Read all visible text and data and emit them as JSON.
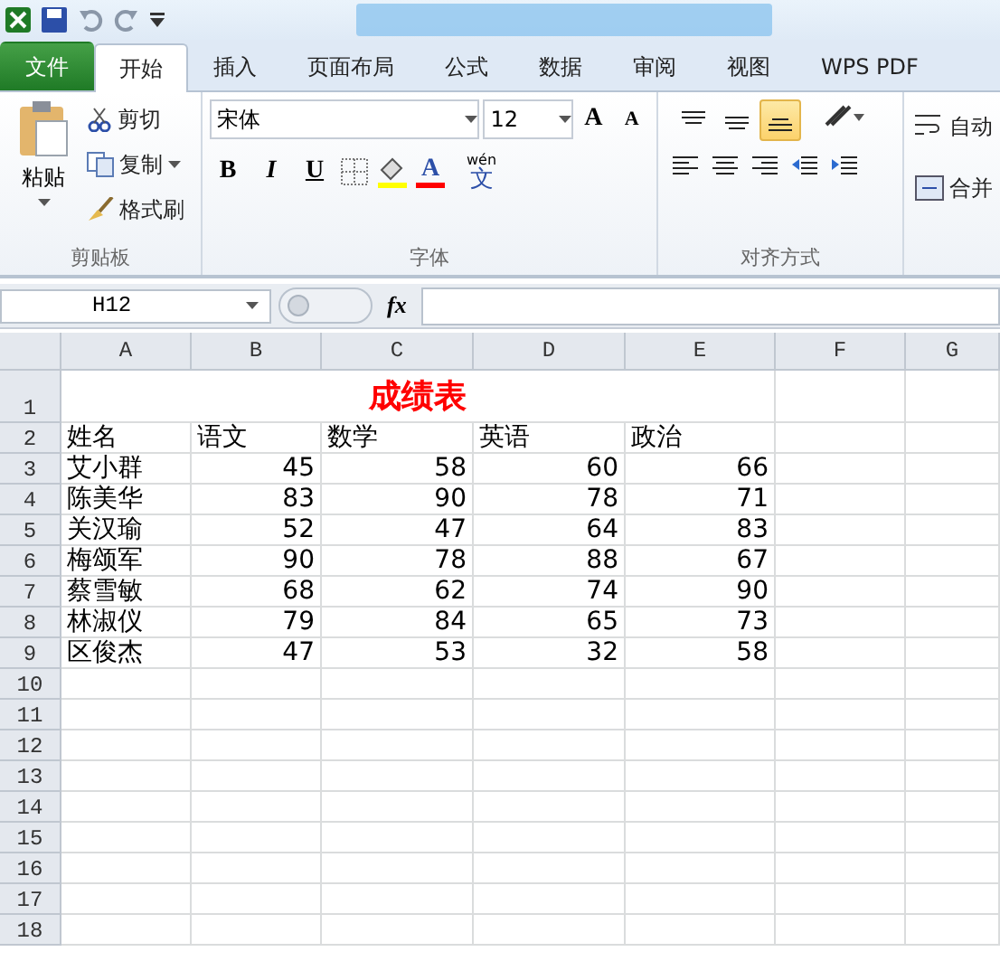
{
  "tabs": [
    {
      "label": "文件",
      "kind": "file",
      "selected": false
    },
    {
      "label": "开始",
      "kind": "tab",
      "selected": true
    },
    {
      "label": "插入",
      "kind": "tab",
      "selected": false
    },
    {
      "label": "页面布局",
      "kind": "tab",
      "selected": false
    },
    {
      "label": "公式",
      "kind": "tab",
      "selected": false
    },
    {
      "label": "数据",
      "kind": "tab",
      "selected": false
    },
    {
      "label": "审阅",
      "kind": "tab",
      "selected": false
    },
    {
      "label": "视图",
      "kind": "tab",
      "selected": false
    },
    {
      "label": "WPS PDF",
      "kind": "tab",
      "selected": false
    }
  ],
  "clipboard": {
    "paste": "粘贴",
    "cut": "剪切",
    "copy": "复制",
    "format_painter": "格式刷",
    "group_label": "剪贴板"
  },
  "font": {
    "name": "宋体",
    "size": "12",
    "style_buttons": [
      "B",
      "I",
      "U"
    ],
    "grow": "A",
    "shrink": "A",
    "font_color": "A",
    "phonetic_top": "wén",
    "phonetic_bottom": "文",
    "group_label": "字体"
  },
  "alignment": {
    "vertical": [
      {
        "selected": false
      },
      {
        "selected": false
      },
      {
        "selected": true
      }
    ],
    "wrap": "自动",
    "merge": "合并",
    "group_label": "对齐方式"
  },
  "name_box": "H12",
  "formula_button": "fx",
  "sheet": {
    "columns": [
      "A",
      "B",
      "C",
      "D",
      "E",
      "F",
      "G"
    ],
    "rows": [
      {
        "number": "1",
        "title": "成绩表"
      },
      {
        "number": "2",
        "cells": [
          "姓名",
          "语文",
          "数学",
          "英语",
          "政治"
        ]
      },
      {
        "number": "3",
        "cells": [
          "艾小群",
          "45",
          "58",
          "60",
          "66"
        ]
      },
      {
        "number": "4",
        "cells": [
          "陈美华",
          "83",
          "90",
          "78",
          "71"
        ]
      },
      {
        "number": "5",
        "cells": [
          "关汉瑜",
          "52",
          "47",
          "64",
          "83"
        ]
      },
      {
        "number": "6",
        "cells": [
          "梅颂军",
          "90",
          "78",
          "88",
          "67"
        ]
      },
      {
        "number": "7",
        "cells": [
          "蔡雪敏",
          "68",
          "62",
          "74",
          "90"
        ]
      },
      {
        "number": "8",
        "cells": [
          "林淑仪",
          "79",
          "84",
          "65",
          "73"
        ]
      },
      {
        "number": "9",
        "cells": [
          "区俊杰",
          "47",
          "53",
          "32",
          "58"
        ]
      },
      {
        "number": "10"
      },
      {
        "number": "11"
      },
      {
        "number": "12"
      },
      {
        "number": "13"
      },
      {
        "number": "14"
      },
      {
        "number": "15"
      },
      {
        "number": "16"
      },
      {
        "number": "17"
      },
      {
        "number": "18"
      }
    ]
  }
}
